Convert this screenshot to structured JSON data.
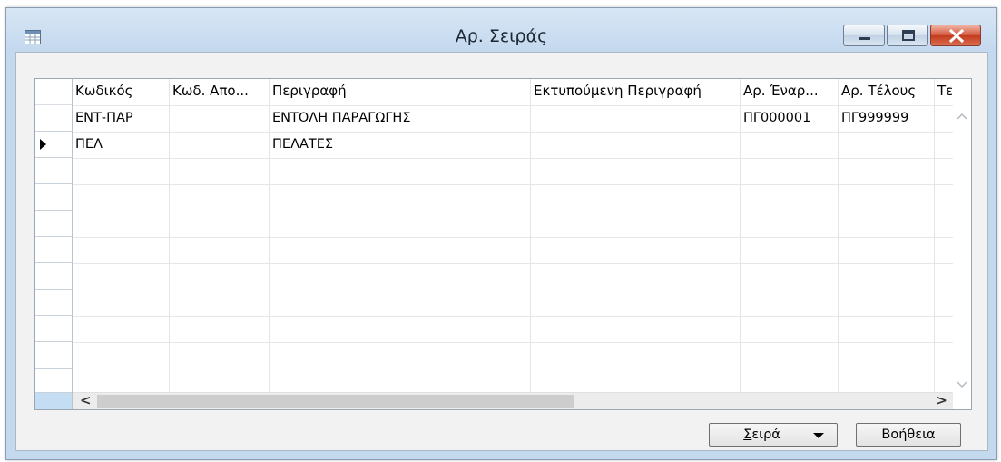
{
  "window": {
    "title": "Αρ. Σειράς"
  },
  "grid": {
    "columns": [
      {
        "label": "Κωδικός"
      },
      {
        "label": "Κωδ. Απο..."
      },
      {
        "label": "Περιγραφή"
      },
      {
        "label": "Εκτυπούμενη Περιγραφή"
      },
      {
        "label": "Αρ. Έναρ..."
      },
      {
        "label": "Αρ. Τέλους"
      },
      {
        "label": "Τε"
      }
    ],
    "rows": [
      {
        "code": "ΕΝΤ-ΠΑΡ",
        "code2": "",
        "description": "ΕΝΤΟΛΗ ΠΑΡΑΓΩΓΗΣ",
        "printed_description": "",
        "start_no": "ΠΓ000001",
        "end_no": "ΠΓ999999"
      },
      {
        "code": "ΠΕΛ",
        "code2": "",
        "description": "ΠΕΛΑΤΕΣ",
        "printed_description": "",
        "start_no": "",
        "end_no": ""
      }
    ],
    "scroll_left_glyph": "<",
    "scroll_right_glyph": ">"
  },
  "buttons": {
    "series_label_first": "Σ",
    "series_label_rest": "ειρά",
    "help_label": "Βοήθεια"
  },
  "icons": {
    "app": "table-icon",
    "minimize": "minimize-icon",
    "maximize": "maximize-icon",
    "close": "close-icon"
  }
}
